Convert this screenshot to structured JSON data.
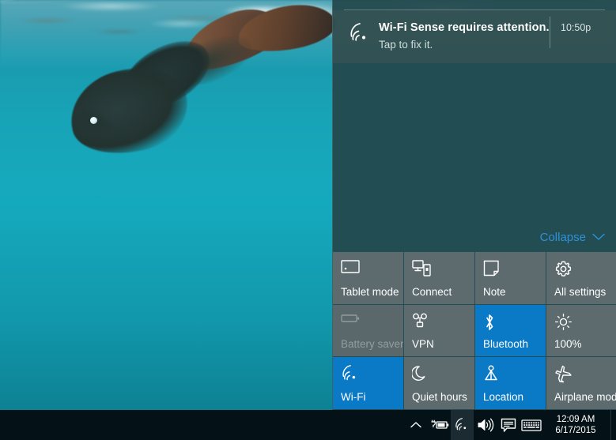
{
  "desktop": {
    "wallpaper_description": "underwater photo of a freediver with a mermaid tail near the surface",
    "colors": {
      "water": "#15a9bd",
      "deep_water": "#0e8194"
    }
  },
  "action_center": {
    "background_color": "#23484c",
    "accent_color": "#0a7ac6",
    "notifications": [
      {
        "icon": "wifi-sense-icon",
        "title": "Wi-Fi Sense requires attention.",
        "subtitle": "Tap to fix it.",
        "time": "10:50p"
      }
    ],
    "collapse": {
      "label": "Collapse",
      "icon": "chevron-down-icon",
      "color": "#2f90d8"
    },
    "quick_actions": [
      {
        "label": "Tablet mode",
        "icon": "tablet-mode-icon",
        "state": "off"
      },
      {
        "label": "Connect",
        "icon": "connect-icon",
        "state": "off"
      },
      {
        "label": "Note",
        "icon": "note-icon",
        "state": "off"
      },
      {
        "label": "All settings",
        "icon": "gear-icon",
        "state": "off"
      },
      {
        "label": "Battery saver",
        "icon": "battery-icon",
        "state": "disabled"
      },
      {
        "label": "VPN",
        "icon": "vpn-icon",
        "state": "off"
      },
      {
        "label": "Bluetooth",
        "icon": "bluetooth-icon",
        "state": "on"
      },
      {
        "label": "100%",
        "icon": "brightness-icon",
        "state": "off"
      },
      {
        "label": "Wi-Fi",
        "icon": "wifi-icon",
        "state": "on"
      },
      {
        "label": "Quiet hours",
        "icon": "moon-icon",
        "state": "off"
      },
      {
        "label": "Location",
        "icon": "location-icon",
        "state": "on"
      },
      {
        "label": "Airplane mode",
        "icon": "airplane-icon",
        "state": "off"
      }
    ]
  },
  "taskbar": {
    "background_color": "#041217",
    "tray_icons": [
      {
        "name": "show-hidden-icons-chevron",
        "glyph": "chevron-up"
      },
      {
        "name": "battery-charging-icon",
        "glyph": "battery-plug"
      },
      {
        "name": "network-wifi-icon",
        "glyph": "wifi",
        "highlighted": true
      },
      {
        "name": "volume-icon",
        "glyph": "speaker"
      },
      {
        "name": "action-center-icon",
        "glyph": "speech-bubble"
      },
      {
        "name": "touch-keyboard-icon",
        "glyph": "keyboard"
      }
    ],
    "clock": {
      "time": "12:09 AM",
      "date": "6/17/2015"
    }
  }
}
